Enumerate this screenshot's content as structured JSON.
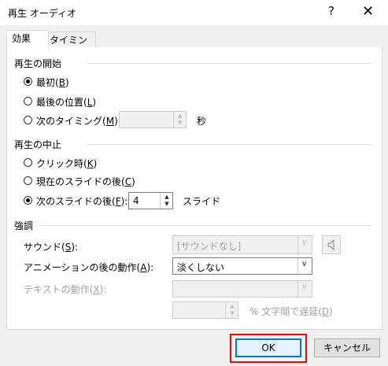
{
  "window": {
    "title": "再生 オーディオ",
    "help_symbol": "?",
    "close_symbol": "✕"
  },
  "tabs": [
    {
      "label": "効果",
      "active": true
    },
    {
      "label": "タイミング",
      "active": false
    }
  ],
  "start_group": {
    "title": "再生の開始",
    "options": [
      {
        "label": "最初",
        "accel": "B",
        "selected": true
      },
      {
        "label": "最後の位置",
        "accel": "L",
        "selected": false
      },
      {
        "label": "次のタイミング",
        "accel": "M",
        "selected": false,
        "suffix": ":"
      }
    ],
    "timing_value": "",
    "timing_unit": "秒"
  },
  "stop_group": {
    "title": "再生の中止",
    "options": [
      {
        "label": "クリック時",
        "accel": "K",
        "selected": false
      },
      {
        "label": "現在のスライドの後",
        "accel": "C",
        "selected": false
      },
      {
        "label": "次のスライドの後",
        "accel": "F",
        "selected": true,
        "suffix": ":"
      }
    ],
    "slides_value": "4",
    "slides_unit": "スライド"
  },
  "enhance_group": {
    "title": "強調",
    "sound_label": "サウンド",
    "sound_accel": "S",
    "sound_value": "[サウンドなし]",
    "after_anim_label": "アニメーションの後の動作",
    "after_anim_accel": "A",
    "after_anim_value": "淡くしない",
    "text_anim_label": "テキストの動作",
    "text_anim_accel": "X",
    "text_anim_value": "",
    "delay_value": "",
    "delay_label": "% 文字間で遅延",
    "delay_accel": "D",
    "sound_icon": "speaker-icon"
  },
  "buttons": {
    "ok": "OK",
    "cancel": "キャンセル"
  },
  "colors": {
    "highlight": "#ff0000",
    "ok_border": "#0078d7"
  }
}
